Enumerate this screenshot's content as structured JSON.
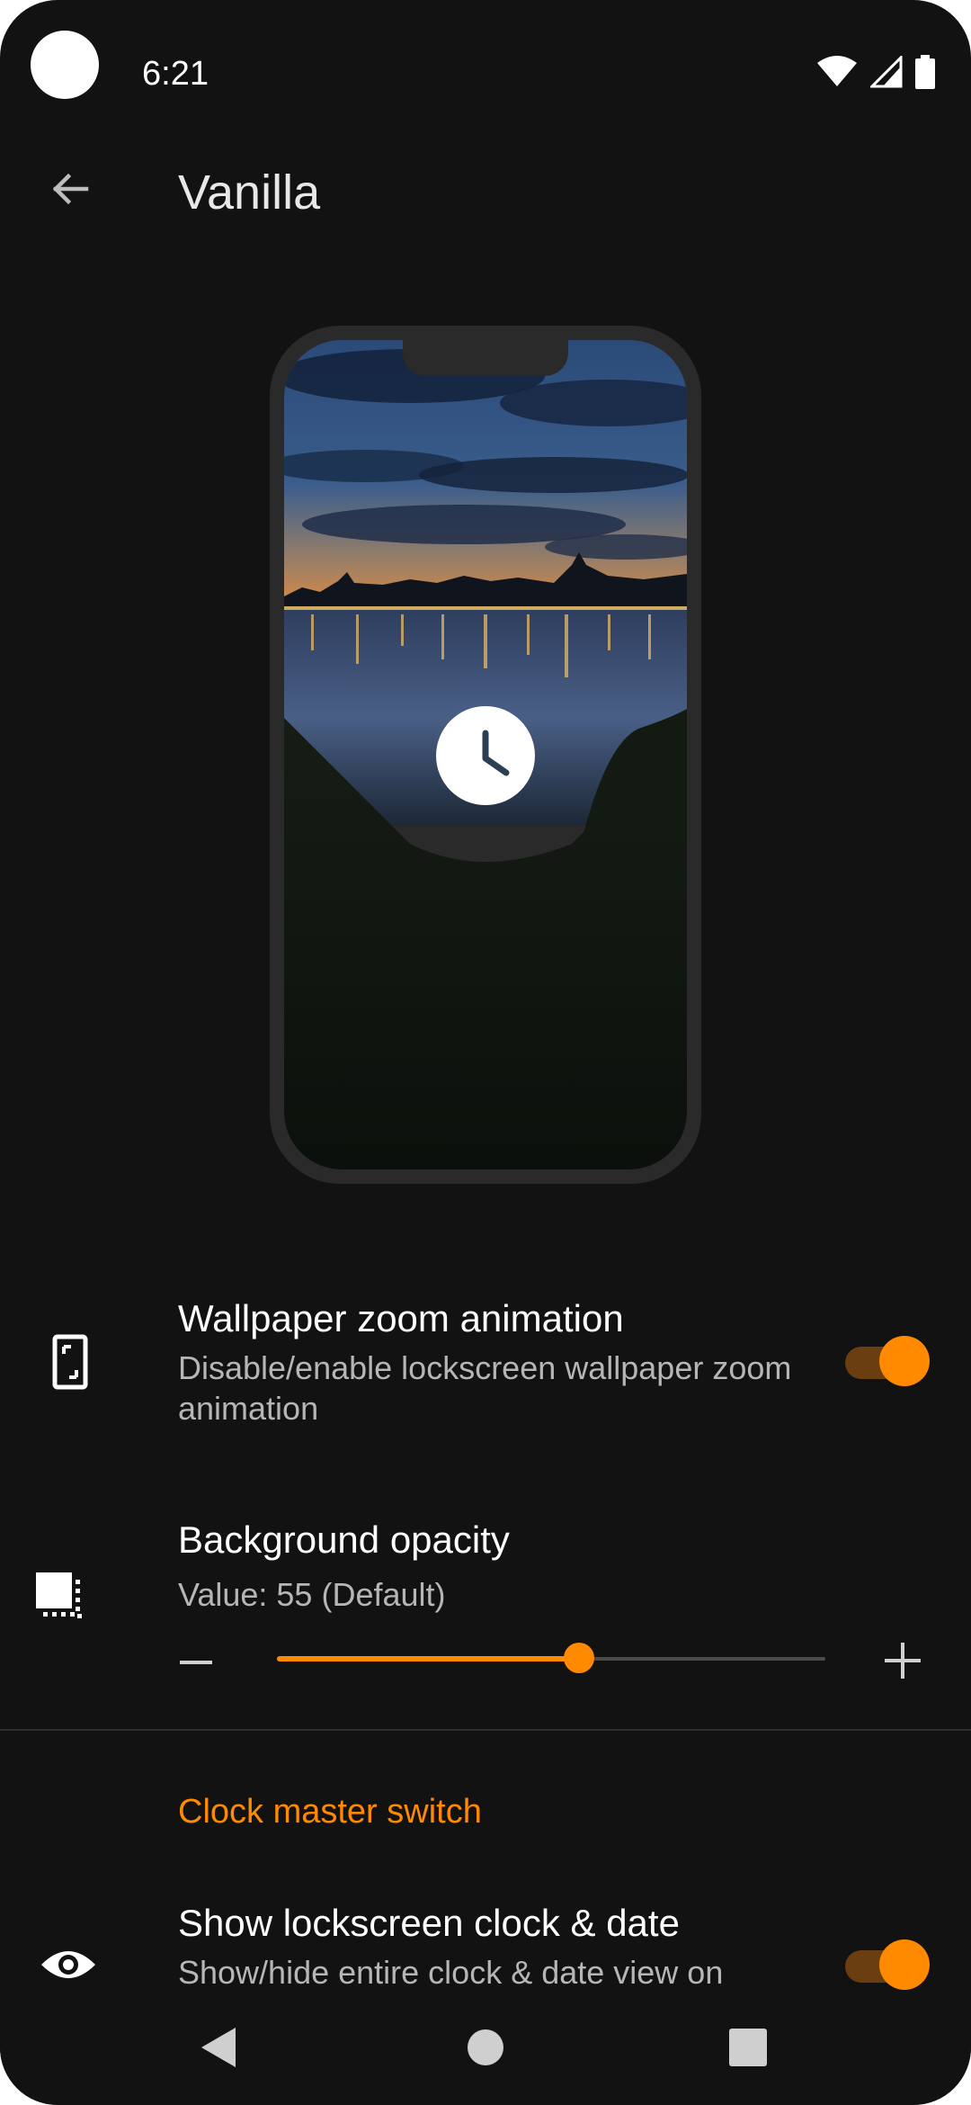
{
  "status_bar": {
    "time": "6:21",
    "icons": [
      "wifi-icon",
      "cellular-signal-icon",
      "battery-icon"
    ]
  },
  "app_bar": {
    "back_icon": "arrow-back-icon",
    "title": "Vanilla"
  },
  "preview": {
    "center_icon": "clock-icon"
  },
  "settings": {
    "wallpaper_zoom": {
      "icon": "phone-zoom-icon",
      "title": "Wallpaper zoom animation",
      "summary": "Disable/enable lockscreen wallpaper zoom animation",
      "enabled": true
    },
    "background_opacity": {
      "icon": "opacity-icon",
      "title": "Background opacity",
      "summary": "Value: 55 (Default)",
      "slider": {
        "value": 55,
        "min": 0,
        "max": 100
      },
      "minus_label": "−",
      "plus_label": "+"
    },
    "section_clock": {
      "header": "Clock master switch"
    },
    "show_clock": {
      "icon": "eye-icon",
      "title": "Show lockscreen clock & date",
      "summary": "Show/hide entire clock & date view on",
      "enabled": true
    }
  },
  "nav_bar": {
    "buttons": [
      "back-triangle-icon",
      "home-circle-icon",
      "recents-square-icon"
    ]
  },
  "colors": {
    "background": "#121212",
    "accent": "#ff8a00",
    "accent_track": "#6b3e12",
    "text_primary": "#ffffff",
    "text_secondary": "#b6b6b6"
  }
}
